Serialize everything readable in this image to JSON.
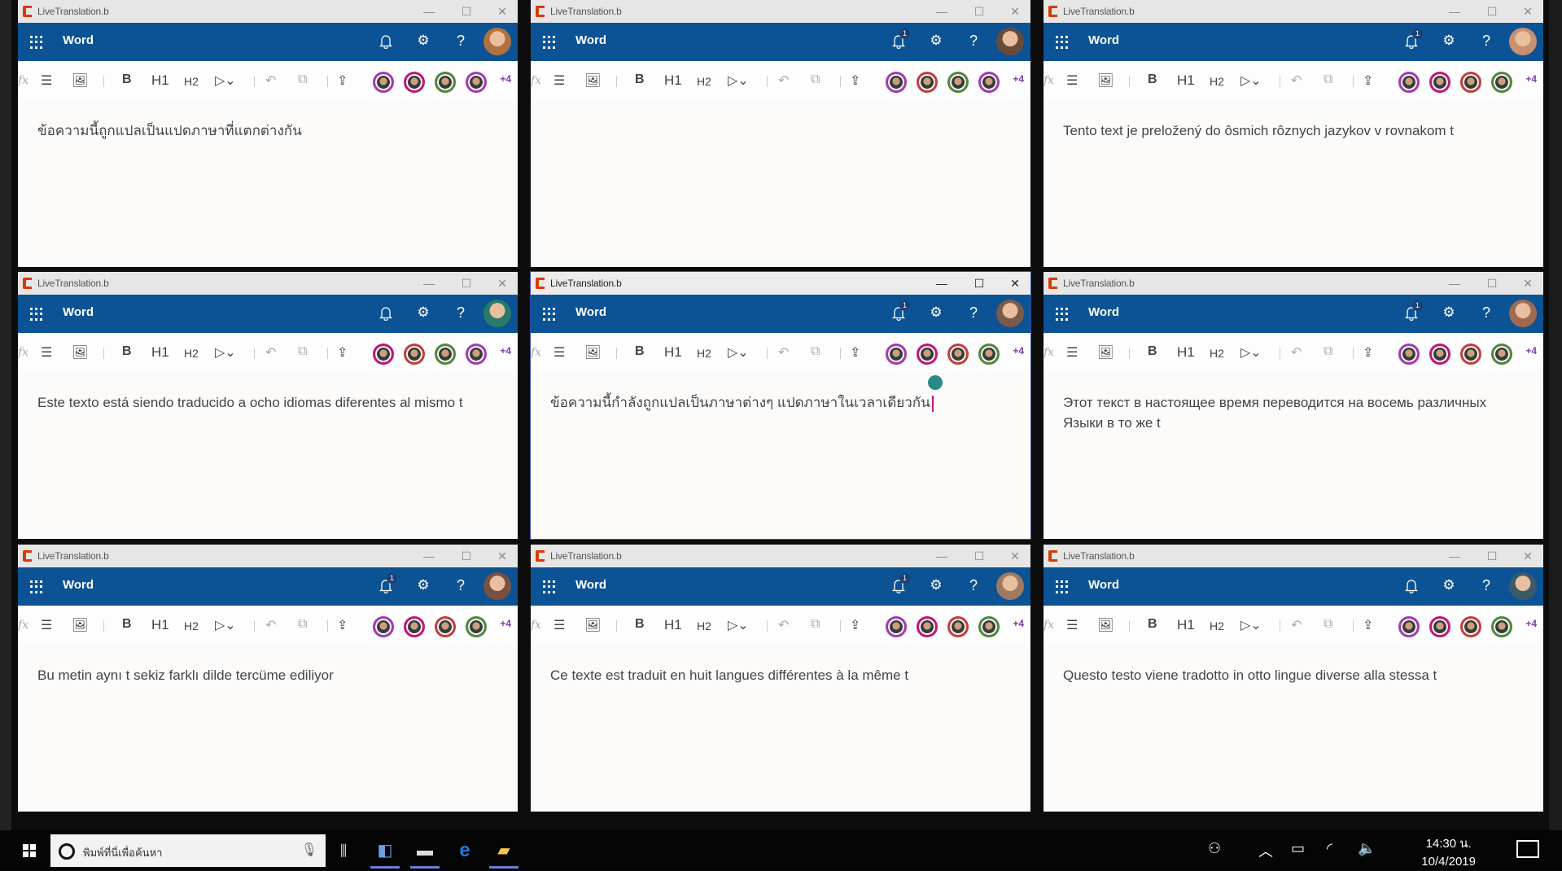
{
  "app": {
    "window_title": "LiveTranslation.b",
    "app_name": "Word",
    "window_controls": {
      "minimize": "—",
      "maximize": "☐",
      "close": "✕"
    },
    "header_color": "#0b5394",
    "toolbar": {
      "formula": "fx",
      "bold": "B",
      "h1": "H1",
      "h2": "H2",
      "more_count": "+4"
    },
    "icons": [
      "waffle-icon",
      "bell-icon",
      "gear-icon",
      "help-icon",
      "list-icon",
      "image-icon",
      "highlight-dropdown-icon",
      "undo-icon",
      "copy-icon",
      "share-icon"
    ]
  },
  "collaborator_colors": {
    "purple": "#a43cb0",
    "magenta": "#c0187a",
    "red": "#c4403a",
    "green": "#4e8a3a"
  },
  "windows": [
    {
      "language": "Thai",
      "text": "ข้อความนี้ถูกแปลเป็นแปดภาษาที่แตกต่างกัน",
      "notifications": "",
      "avatar_color": "#b07040",
      "rings": [
        "#a43cb0",
        "#c0187a",
        "#4e8a3a",
        "#a43cb0"
      ]
    },
    {
      "language": "Unknown",
      "text": "",
      "notifications": "1",
      "avatar_color": "#6a4a3a",
      "rings": [
        "#a43cb0",
        "#c4403a",
        "#4e8a3a",
        "#a43cb0"
      ]
    },
    {
      "language": "Slovak",
      "text": "Tento text je preložený do ôsmich rôznych jazykov v rovnakom t",
      "notifications": "1",
      "avatar_color": "#c89070",
      "rings": [
        "#a43cb0",
        "#c0187a",
        "#c4403a",
        "#4e8a3a"
      ]
    },
    {
      "language": "Spanish",
      "text": "Este texto está siendo traducido a ocho idiomas diferentes al mismo t",
      "notifications": "",
      "avatar_color": "#2a7a6a",
      "rings": [
        "#c0187a",
        "#c4403a",
        "#4e8a3a",
        "#a43cb0"
      ]
    },
    {
      "language": "Thai",
      "text": "ข้อความนี้กำลังถูกแปลเป็นภาษาต่างๆ แปดภาษาในเวลาเดียวกัน",
      "notifications": "1",
      "avatar_color": "#7a5a4a",
      "rings": [
        "#a43cb0",
        "#c0187a",
        "#c4403a",
        "#4e8a3a"
      ],
      "active": true
    },
    {
      "language": "Russian",
      "text": "Этот текст в настоящее время переводится на восемь различных Языки в то же t",
      "notifications": "1",
      "avatar_color": "#a06a50",
      "rings": [
        "#a43cb0",
        "#c0187a",
        "#c4403a",
        "#4e8a3a"
      ]
    },
    {
      "language": "Turkish",
      "text": "Bu metin aynı t sekiz farklı dilde tercüme ediliyor",
      "notifications": "1",
      "avatar_color": "#7a5040",
      "rings": [
        "#a43cb0",
        "#c0187a",
        "#c4403a",
        "#4e8a3a"
      ]
    },
    {
      "language": "French",
      "text": "Ce texte est traduit en huit langues différentes à la même t",
      "notifications": "1",
      "avatar_color": "#a07a60",
      "rings": [
        "#a43cb0",
        "#c0187a",
        "#c4403a",
        "#4e8a3a"
      ]
    },
    {
      "language": "Italian",
      "text": "Questo testo viene tradotto in otto lingue diverse alla stessa t",
      "notifications": "",
      "avatar_color": "#3a5a6a",
      "rings": [
        "#a43cb0",
        "#c0187a",
        "#c4403a",
        "#4e8a3a"
      ]
    }
  ],
  "taskbar": {
    "search_placeholder": "พิมพ์ที่นี่เพื่อค้นหา",
    "time": "14:30 น.",
    "date": "10/4/2019",
    "pinned": [
      "task-view",
      "notepad-app",
      "terminal-app",
      "edge-browser",
      "file-explorer"
    ]
  }
}
